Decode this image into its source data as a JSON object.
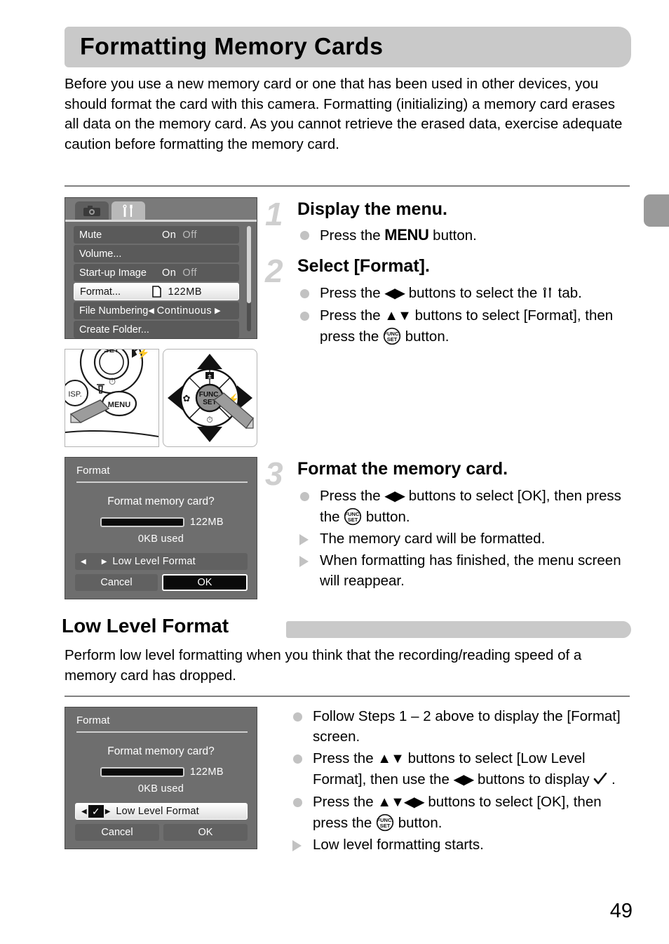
{
  "page": {
    "title": "Formatting Memory Cards",
    "number": "49",
    "intro": "Before you use a new memory card or one that has been used in other devices, you should format the card with this camera. Formatting (initializing) a memory card erases all data on the memory card. As you cannot retrieve the erased data, exercise adequate caution before formatting the memory card."
  },
  "camera_menu": {
    "tabs": [
      {
        "name": "shooting-tab",
        "icon": "camera-icon",
        "active": false
      },
      {
        "name": "settings-tab",
        "icon": "wrench-screwdriver-icon",
        "active": true
      }
    ],
    "rows": [
      {
        "label": "Mute",
        "value_on": "On",
        "value_off": "Off",
        "selected": false
      },
      {
        "label": "Volume...",
        "value": "",
        "selected": false
      },
      {
        "label": "Start-up Image",
        "value_on": "On",
        "value_off": "Off",
        "selected": false
      },
      {
        "label": "Format...",
        "value": "122MB",
        "icon": "memory-card-icon",
        "selected": true
      },
      {
        "label": "File Numbering",
        "value": "Continuous",
        "arrows": true,
        "selected": false
      },
      {
        "label": "Create Folder...",
        "value": "",
        "selected": false
      }
    ]
  },
  "format_dialog_1": {
    "title": "Format",
    "question": "Format memory card?",
    "size": "122MB",
    "used": "0KB used",
    "low_level_label": "Low Level Format",
    "low_level_checked": false,
    "cancel_label": "Cancel",
    "ok_label": "OK",
    "focus": "ok"
  },
  "format_dialog_2": {
    "title": "Format",
    "question": "Format memory card?",
    "size": "122MB",
    "used": "0KB used",
    "low_level_label": "Low Level Format",
    "low_level_checked": true,
    "check_glyph": "✓",
    "cancel_label": "Cancel",
    "ok_label": "OK",
    "focus": "low-level-format"
  },
  "diagrams": [
    {
      "name": "menu-button-diagram",
      "caption": ""
    },
    {
      "name": "func-set-pad-diagram",
      "caption": ""
    }
  ],
  "steps": [
    {
      "number": "1",
      "heading": "Display the menu.",
      "lines": [
        {
          "marker": "dot",
          "parts": [
            {
              "t": "text",
              "v": "Press the "
            },
            {
              "t": "menu",
              "v": "MENU"
            },
            {
              "t": "text",
              "v": " button."
            }
          ]
        }
      ]
    },
    {
      "number": "2",
      "heading": "Select [Format].",
      "lines": [
        {
          "marker": "dot",
          "parts": [
            {
              "t": "text",
              "v": "Press the "
            },
            {
              "t": "lr",
              "v": "◀▶"
            },
            {
              "t": "text",
              "v": " buttons to select the "
            },
            {
              "t": "settings",
              "v": "settings-tab-icon"
            },
            {
              "t": "text",
              "v": " tab."
            }
          ]
        },
        {
          "marker": "dot",
          "parts": [
            {
              "t": "text",
              "v": "Press the "
            },
            {
              "t": "ud",
              "v": "▲▼"
            },
            {
              "t": "text",
              "v": " buttons to select [Format], then press the "
            },
            {
              "t": "func",
              "v": "func-set-icon"
            },
            {
              "t": "text",
              "v": " button."
            }
          ]
        }
      ]
    },
    {
      "number": "3",
      "heading": "Format the memory card.",
      "lines": [
        {
          "marker": "dot",
          "parts": [
            {
              "t": "text",
              "v": "Press the "
            },
            {
              "t": "lr",
              "v": "◀▶"
            },
            {
              "t": "text",
              "v": " buttons to select [OK], then press the "
            },
            {
              "t": "func",
              "v": "func-set-icon"
            },
            {
              "t": "text",
              "v": " button."
            }
          ]
        },
        {
          "marker": "tri",
          "parts": [
            {
              "t": "text",
              "v": "The memory card will be formatted."
            }
          ]
        },
        {
          "marker": "tri",
          "parts": [
            {
              "t": "text",
              "v": "When formatting has finished, the menu screen will reappear."
            }
          ]
        }
      ]
    }
  ],
  "section": {
    "heading": "Low Level Format",
    "body": "Perform low level formatting when you think that the recording/reading speed of a memory card has dropped.",
    "lines": [
      {
        "marker": "dot",
        "parts": [
          {
            "t": "text",
            "v": "Follow Steps 1 – 2 above to display the [Format] screen."
          }
        ]
      },
      {
        "marker": "dot",
        "parts": [
          {
            "t": "text",
            "v": "Press the "
          },
          {
            "t": "ud",
            "v": "▲▼"
          },
          {
            "t": "text",
            "v": " buttons to select [Low Level Format], then use the "
          },
          {
            "t": "lr",
            "v": "◀▶"
          },
          {
            "t": "text",
            "v": " buttons to display "
          },
          {
            "t": "check",
            "v": "check-icon"
          },
          {
            "t": "text",
            "v": " ."
          }
        ]
      },
      {
        "marker": "dot",
        "parts": [
          {
            "t": "text",
            "v": "Press the "
          },
          {
            "t": "ud",
            "v": "▲▼"
          },
          {
            "t": "lr",
            "v": "◀▶"
          },
          {
            "t": "text",
            "v": " buttons to select [OK], then press the "
          },
          {
            "t": "func",
            "v": "func-set-icon"
          },
          {
            "t": "text",
            "v": " button."
          }
        ]
      },
      {
        "marker": "tri",
        "parts": [
          {
            "t": "text",
            "v": "Low level formatting starts."
          }
        ]
      }
    ]
  },
  "colors": {
    "banner": "#c9c9c9",
    "lcd_background": "#6e6e6e",
    "step_number": "#cfcfcf",
    "bullet": "#c2c2c2",
    "divider": "#808080"
  }
}
